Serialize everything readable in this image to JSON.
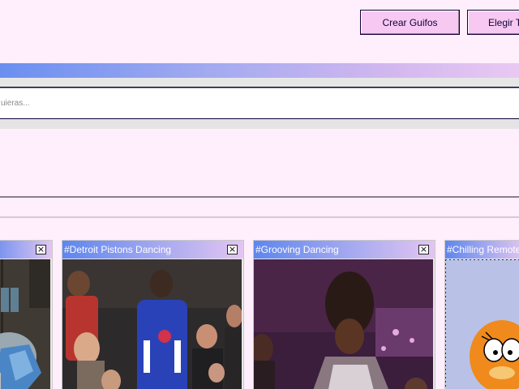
{
  "nav": {
    "create_label": "Crear Guifos",
    "theme_label": "Elegir Tema"
  },
  "search": {
    "placeholder": "Búsqueda de GIFs, busca lo que quieras..."
  },
  "cards": [
    {
      "title": "",
      "close": "×"
    },
    {
      "title": "#Detroit Pistons Dancing",
      "close": "×"
    },
    {
      "title": "#Grooving Dancing",
      "close": "×"
    },
    {
      "title": "#Chilling Remote Control",
      "close": ""
    }
  ]
}
